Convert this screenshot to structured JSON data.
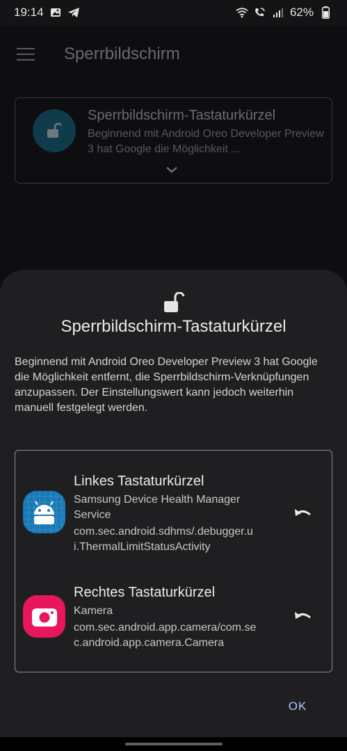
{
  "status_bar": {
    "time": "19:14",
    "battery": "62%",
    "icons": [
      "image-icon",
      "telegram-icon",
      "wifi-icon",
      "wifi-calling-icon",
      "signal-icon",
      "battery-icon"
    ]
  },
  "background": {
    "app_title": "Sperrbildschirm",
    "card_title": "Sperrbildschirm-Tastaturkürzel",
    "card_desc": "Beginnend mit Android Oreo Developer Preview 3 hat Google die Möglichkeit ..."
  },
  "dialog": {
    "title": "Sperrbildschirm-Tastaturkürzel",
    "description": "Beginnend mit Android Oreo Developer Preview 3 hat Google die Möglichkeit entfernt, die Sperrbildschirm-Verknüpfungen anzupassen. Der Einstellungswert kann jedoch weiterhin manuell festgelegt werden.",
    "items": [
      {
        "title": "Linkes Tastaturkürzel",
        "app": "Samsung Device Health Manager Service",
        "component": "com.sec.android.sdhms/.debugger.ui.ThermalLimitStatusActivity"
      },
      {
        "title": "Rechtes Tastaturkürzel",
        "app": "Kamera",
        "component": "com.sec.android.app.camera/com.sec.android.app.camera.Camera"
      }
    ],
    "ok_label": "OK"
  },
  "colors": {
    "accent": "#a8c8ff",
    "sheet_bg": "#1f1f22",
    "camera_icon": "#e8175d",
    "health_icon": "#1a78b4"
  }
}
